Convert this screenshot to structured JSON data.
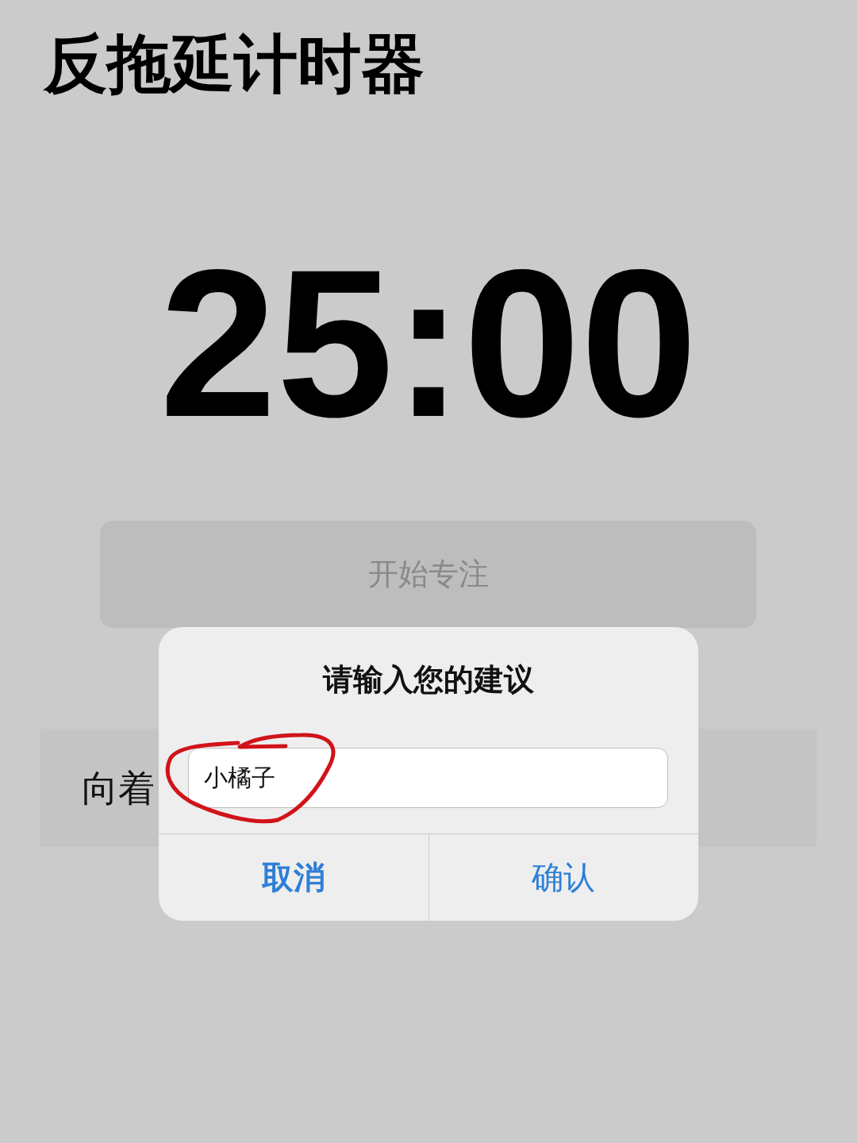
{
  "title": "反拖延计时器",
  "timer": "25:00",
  "start_button": {
    "label": "开始专注"
  },
  "banner": {
    "text": "向着"
  },
  "dialog": {
    "title": "请输入您的建议",
    "input": {
      "value": "小橘子",
      "circled": true
    },
    "buttons": [
      {
        "label": "取消",
        "kind": "cancel"
      },
      {
        "label": "确认",
        "kind": "confirm"
      }
    ]
  }
}
